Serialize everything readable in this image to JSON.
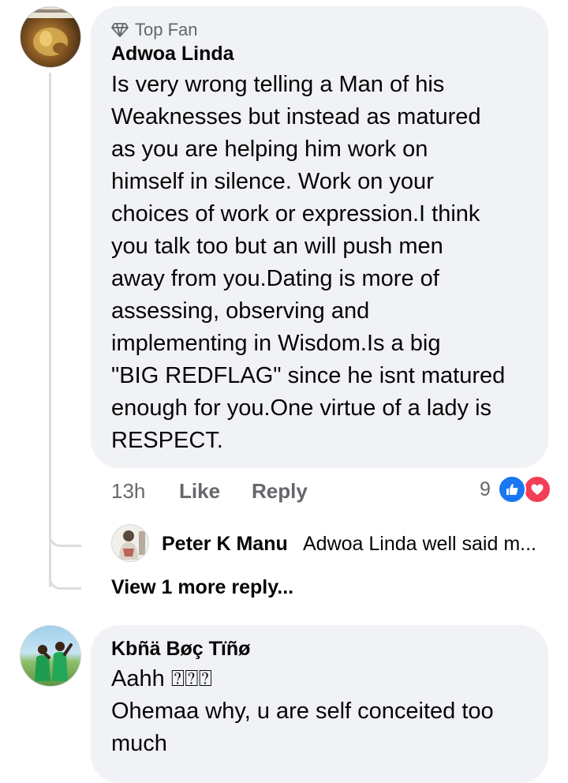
{
  "comments": [
    {
      "badge": "Top Fan",
      "author": "Adwoa Linda",
      "lines": [
        "Is very wrong telling a Man of his",
        "Weaknesses but instead as matured",
        "as you are helping him work on",
        "himself in silence. Work on your",
        "choices of work or expression.I think",
        "you talk too but an will push men",
        "away from you.Dating is more of",
        "assessing, observing and",
        "implementing in Wisdom.Is a big",
        "\"BIG REDFLAG\" since he isnt matured",
        "enough for you.One virtue of a lady is",
        "RESPECT."
      ],
      "time": "13h",
      "like_label": "Like",
      "reply_label": "Reply",
      "reaction_count": "9",
      "reactions": [
        "like-icon",
        "love-icon"
      ],
      "reply_preview": {
        "author": "Peter K Manu",
        "text": "Adwoa Linda  well said m..."
      },
      "view_more_label": "View 1 more reply..."
    },
    {
      "author": "Kbñä Bøç Tïñø",
      "lines": [
        "Aahh ⍰⍰⍰",
        "Ohemaa why, u are self conceited too",
        "much"
      ]
    }
  ],
  "colors": {
    "bubble": "#f0f2f5",
    "meta_text": "#65676b",
    "like_blue": "#1877f2",
    "love_red": "#f33e58"
  }
}
